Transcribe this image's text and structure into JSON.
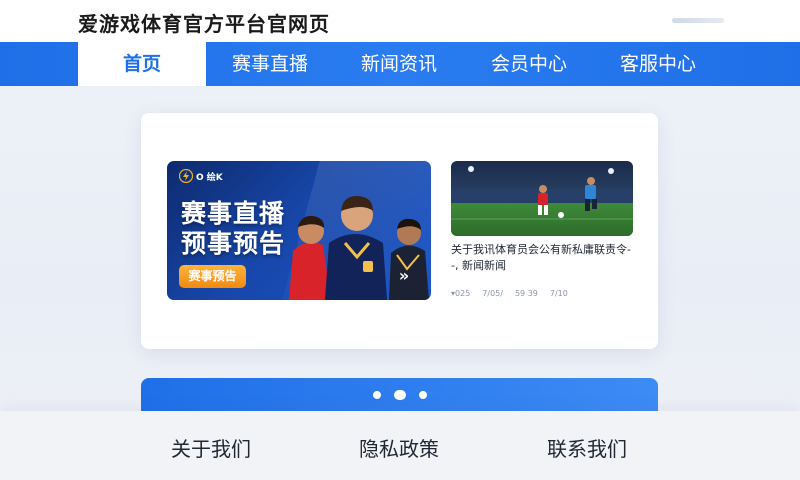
{
  "header": {
    "site_title": "爱游戏体育官方平台官网页"
  },
  "nav": {
    "items": [
      {
        "label": "首页",
        "active": true
      },
      {
        "label": "赛事直播",
        "active": false
      },
      {
        "label": "新闻资讯",
        "active": false
      },
      {
        "label": "会员中心",
        "active": false
      },
      {
        "label": "客服中心",
        "active": false
      }
    ]
  },
  "banner": {
    "logo_text": "O 绘K",
    "headline_1": "赛事直播",
    "headline_2": "预事预告",
    "button_label": "赛事预告",
    "arrow": "»"
  },
  "news": {
    "title": "关于我讯体育员会公有新私庸联责令--, 新闻新闻",
    "meta": [
      "▾025",
      "7/05/",
      "59 39",
      "7/10"
    ]
  },
  "carousel": {
    "dot_count": 3,
    "active_index": 1
  },
  "footer": {
    "links": [
      "关于我们",
      "隐私政策",
      "联系我们"
    ]
  },
  "colors": {
    "primary": "#1f6fe8",
    "accent_orange": "#f08a12",
    "banner_dark": "#0d2a6e"
  }
}
